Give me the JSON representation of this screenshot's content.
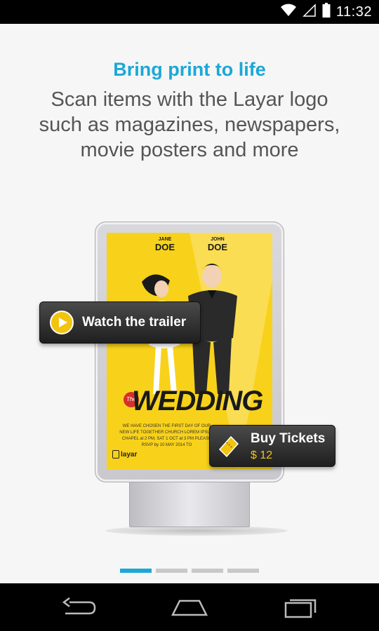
{
  "status_bar": {
    "time": "11:32",
    "icons": [
      "wifi-icon",
      "signal-icon",
      "battery-icon"
    ]
  },
  "headline": "Bring print to life",
  "description_lines": [
    "Scan items with the Layar logo",
    "such as magazines, newspapers,",
    "movie posters and more"
  ],
  "poster": {
    "jane_first": "JANE",
    "jane_last": "DOE",
    "john_first": "JOHN",
    "john_last": "DOE",
    "the": "The",
    "title": "WEDDING",
    "credits": "WE HAVE CHOSEN THE FIRST DAY OF OUR NEW LIFE TOGETHER CHURCH LOREM IPSUM CHAPEL at 2 PM, SAT 1 OCT at 3 PM PLEASE RSVP by 10 MAY 2014 TO",
    "logo_text": "layar"
  },
  "overlays": {
    "trailer_label": "Watch the trailer",
    "tickets_label": "Buy Tickets",
    "tickets_price": "$ 12"
  },
  "pager": {
    "count": 4,
    "active": 0
  },
  "colors": {
    "accent": "#1ba8d6",
    "poster_yellow": "#f8d21a",
    "button_yellow": "#f2c40f"
  },
  "nav": [
    "back-icon",
    "home-icon",
    "recents-icon"
  ]
}
